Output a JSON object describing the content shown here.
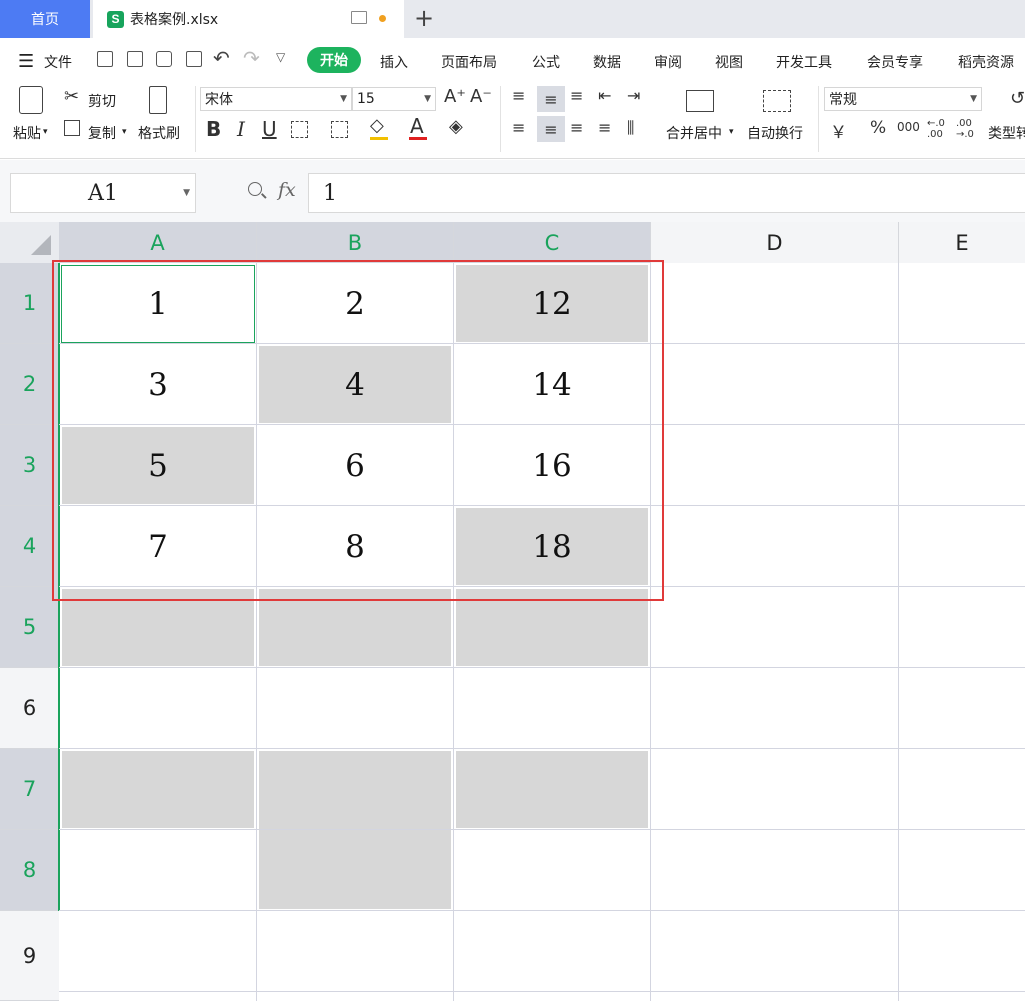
{
  "tabs": {
    "home": "首页",
    "file_icon_letter": "S",
    "file_name": "表格案例.xlsx",
    "new_tab": "+"
  },
  "menu": {
    "file": "文件",
    "items": [
      "开始",
      "插入",
      "页面布局",
      "公式",
      "数据",
      "审阅",
      "视图",
      "开发工具",
      "会员专享",
      "稻壳资源"
    ]
  },
  "toolbar": {
    "paste": "粘贴",
    "cut": "剪切",
    "copy": "复制",
    "format_painter": "格式刷",
    "font_name": "宋体",
    "font_size": "15",
    "bold": "B",
    "italic": "I",
    "underline": "U",
    "merge_center": "合并居中",
    "wrap_text": "自动换行",
    "number_format": "常规",
    "currency": "￥",
    "percent": "%",
    "thousands": "000",
    "inc_decimal": "←.0 .00",
    "dec_decimal": ".00 →.0",
    "type_convert": "类型转"
  },
  "formula_bar": {
    "cell_ref": "A1",
    "fx": "fx",
    "value": "1"
  },
  "grid": {
    "columns": [
      "A",
      "B",
      "C",
      "D",
      "E"
    ],
    "rows": [
      "1",
      "2",
      "3",
      "4",
      "5",
      "6",
      "7",
      "8",
      "9"
    ],
    "cells": [
      [
        "1",
        "2",
        "12"
      ],
      [
        "3",
        "4",
        "14"
      ],
      [
        "5",
        "6",
        "16"
      ],
      [
        "7",
        "8",
        "18"
      ]
    ]
  },
  "colors": {
    "accent_green": "#1db35e",
    "home_tab_blue": "#4d7bf3",
    "highlight_fill": "#d7d7d7",
    "selection_red": "#e03a3a"
  }
}
